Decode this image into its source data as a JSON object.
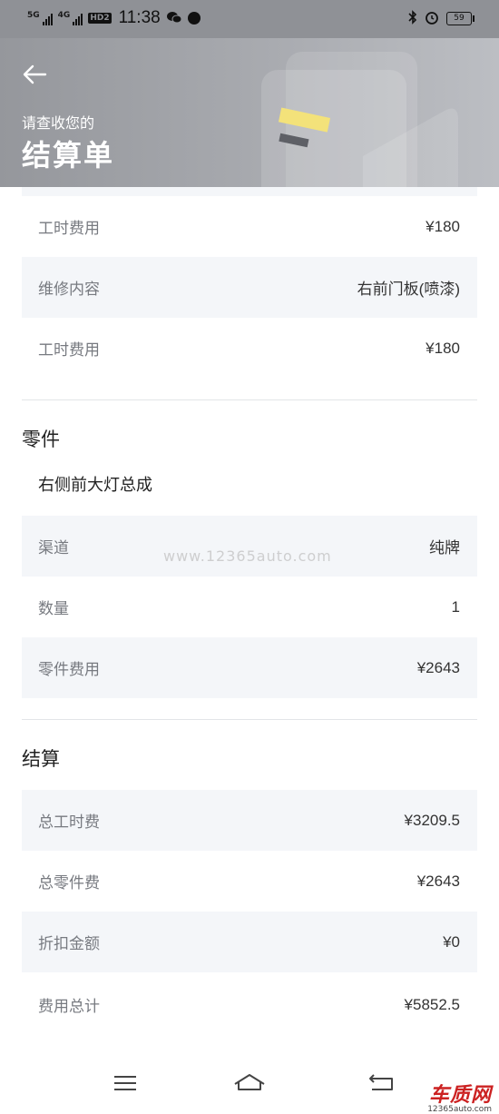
{
  "status_bar": {
    "network1": "5G",
    "network2": "4G",
    "hd_badge": "HD2",
    "time": "11:38",
    "battery": "59"
  },
  "header": {
    "subtitle": "请查收您的",
    "title": "结算单"
  },
  "labor_rows": [
    {
      "label": "工时费用",
      "value": "¥180"
    },
    {
      "label": "维修内容",
      "value": "右前门板(喷漆)"
    },
    {
      "label": "工时费用",
      "value": "¥180"
    }
  ],
  "parts": {
    "title": "零件",
    "item_name": "右侧前大灯总成",
    "rows": [
      {
        "label": "渠道",
        "value": "纯牌"
      },
      {
        "label": "数量",
        "value": "1"
      },
      {
        "label": "零件费用",
        "value": "¥2643"
      }
    ]
  },
  "settlement": {
    "title": "结算",
    "rows": [
      {
        "label": "总工时费",
        "value": "¥3209.5"
      },
      {
        "label": "总零件费",
        "value": "¥2643"
      },
      {
        "label": "折扣金额",
        "value": "¥0"
      },
      {
        "label": "费用总计",
        "value": "¥5852.5"
      }
    ]
  },
  "watermark": "www.12365auto.com",
  "brand": {
    "name": "车质网",
    "url": "12365auto.com"
  },
  "colors": {
    "header_bg": "#a9abb0",
    "accent_yellow": "#f3e27a",
    "row_shade": "#f4f6f9"
  }
}
